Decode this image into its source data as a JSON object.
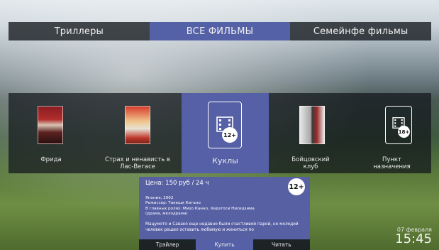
{
  "tabs": [
    {
      "label": "Триллеры",
      "active": false
    },
    {
      "label": "ВСЕ ФИЛЬМЫ",
      "active": true
    },
    {
      "label": "Семейнфе фильмы",
      "active": false
    }
  ],
  "carousel": {
    "items": [
      {
        "title": "Фрида",
        "poster_icon": "poster-image",
        "selected": false
      },
      {
        "title": "Страх и ненависть в Лас-Вегасе",
        "poster_icon": "poster-image",
        "selected": false
      },
      {
        "title": "Куклы",
        "poster_icon": "film-icon",
        "age": "12+",
        "selected": true
      },
      {
        "title": "Бойцовский клуб",
        "poster_icon": "poster-image",
        "selected": false
      },
      {
        "title": "Пункт назначения",
        "poster_icon": "film-icon",
        "age": "18+",
        "selected": false
      }
    ]
  },
  "details": {
    "price": "Цена: 150 руб / 24 ч",
    "age": "12+",
    "meta_line1": "Япония, 2002",
    "meta_line2": "Режиссер: Такеши Китано",
    "meta_line3": "В главных ролях:  Михо Канно, Хидэтоси Нисидзима",
    "meta_line4": "(драма, мелодрама)",
    "description": "Мацумото и Савако еще недавно были счастливой парой, но молодой человек решил оставить любимую и жениться по"
  },
  "actions": [
    {
      "label": "Трэйлер",
      "active": false
    },
    {
      "label": "Купить",
      "active": true
    },
    {
      "label": "Читать",
      "active": false
    }
  ],
  "clock": {
    "date": "07 февраля",
    "time": "15:45"
  },
  "colors": {
    "accent": "#5560a6",
    "dark_bar": "#14181e"
  }
}
